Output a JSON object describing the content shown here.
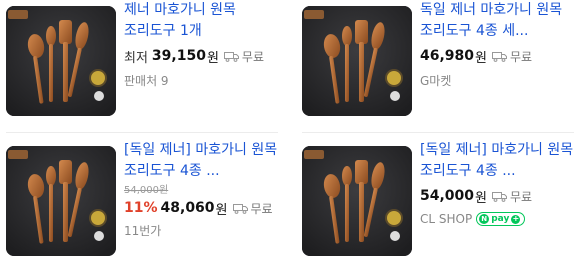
{
  "products": [
    {
      "title": "제너 마호가니 원목 조리도구 1개",
      "lowest_label": "최저",
      "price": "39,150",
      "won": "원",
      "shipping": "무료",
      "seller": "판매처 9",
      "image_icon": "spoon-set-image"
    },
    {
      "title": "독일 제너 마호가니 원목 조리도구 4종 세...",
      "price": "46,980",
      "won": "원",
      "shipping": "무료",
      "seller": "G마켓",
      "image_icon": "spoon-set-image"
    },
    {
      "title": "[독일 제너] 마호가니 원목 조리도구 4종 ...",
      "original_price": "54,000원",
      "discount": "11%",
      "price": "48,060",
      "won": "원",
      "shipping": "무료",
      "seller": "11번가",
      "image_icon": "spoon-set-image"
    },
    {
      "title": "[독일 제너] 마호가니 원목 조리도구 4종 ...",
      "price": "54,000",
      "won": "원",
      "shipping": "무료",
      "seller": "CL SHOP",
      "npay_label": "pay",
      "npay_n": "N",
      "npay_plus": "+",
      "image_icon": "spoon-set-image"
    }
  ],
  "colors": {
    "title": "#1a54d4",
    "discount": "#e0412a",
    "npay": "#03c75a"
  }
}
